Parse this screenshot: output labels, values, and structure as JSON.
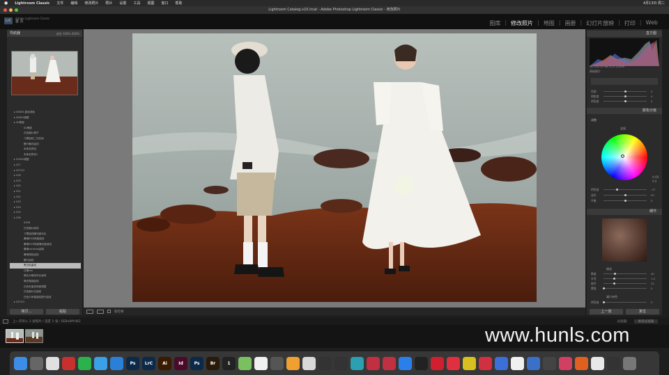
{
  "menubar": {
    "app": "Lightroom Classic",
    "items": [
      "文件",
      "编辑",
      "修改照片",
      "照片",
      "设置",
      "工具",
      "视图",
      "窗口",
      "帮助"
    ],
    "clock": "4月13日 周二"
  },
  "window": {
    "title": "Lightroom Catalog-v10.lrcat - Adobe Photoshop Lightroom Classic - 修改照片"
  },
  "identity": {
    "logo": "LrC",
    "line1": "Adobe Lightroom Classic",
    "line2": "首 页"
  },
  "modules": [
    {
      "label": "图库",
      "active": false
    },
    {
      "label": "修改照片",
      "active": true
    },
    {
      "label": "地图",
      "active": false
    },
    {
      "label": "画册",
      "active": false
    },
    {
      "label": "幻灯片放映",
      "active": false
    },
    {
      "label": "打印",
      "active": false
    },
    {
      "label": "Web",
      "active": false
    }
  ],
  "left_panel": {
    "navigator_title": "导航器",
    "nav_zoom": "适合  100%  400%",
    "presets": [
      {
        "t": "folder",
        "label": "S0603-蓝色调色"
      },
      {
        "t": "folder",
        "label": "S0603调整"
      },
      {
        "t": "folder",
        "label": "S0黑银"
      },
      {
        "t": "item",
        "label": "S0黑银"
      },
      {
        "t": "item",
        "label": "白色婚纱调子"
      },
      {
        "t": "item",
        "label": "习惯曲线二次应用"
      },
      {
        "t": "item",
        "label": "履行曝光曲线"
      },
      {
        "t": "item",
        "label": "未命名预设"
      },
      {
        "t": "item",
        "label": "未命名预设1"
      },
      {
        "t": "folder",
        "label": "S2603调整"
      },
      {
        "t": "folder",
        "label": "S27"
      },
      {
        "t": "folder",
        "label": "S27CH"
      },
      {
        "t": "folder",
        "label": "S28"
      },
      {
        "t": "folder",
        "label": "S29"
      },
      {
        "t": "folder",
        "label": "S30"
      },
      {
        "t": "folder",
        "label": "S31"
      },
      {
        "t": "folder",
        "label": "S32"
      },
      {
        "t": "folder",
        "label": "S33"
      },
      {
        "t": "folder",
        "label": "S34"
      },
      {
        "t": "folder",
        "label": "S35"
      },
      {
        "t": "folder",
        "label": "S36"
      },
      {
        "t": "item",
        "label": "0406"
      },
      {
        "t": "item",
        "label": "白色婚纱曲线"
      },
      {
        "t": "item",
        "label": "习惯曲线曝光度对比"
      },
      {
        "t": "item",
        "label": "暴晒RGB亮度曲线"
      },
      {
        "t": "item",
        "label": "暴晒RGB亮度曝光度曲线"
      },
      {
        "t": "item",
        "label": "暴晒contrast曲线"
      },
      {
        "t": "item",
        "label": "暴晒调色曲线"
      },
      {
        "t": "item",
        "label": "履行曲线"
      },
      {
        "t": "sel",
        "label": "黑白色曲线"
      },
      {
        "t": "item",
        "label": "日期feo"
      },
      {
        "t": "item",
        "label": "暗光大暗线对比曲线"
      },
      {
        "t": "item",
        "label": "暗光增强曲线"
      },
      {
        "t": "item",
        "label": "白色系曲线亮度调整"
      },
      {
        "t": "item",
        "label": "白色婚纱白曲线"
      },
      {
        "t": "item",
        "label": "白色中间调曲线提升曲线"
      },
      {
        "t": "folder",
        "label": "S37CH"
      }
    ],
    "btn_copy": "拷贝...",
    "btn_paste": "粘贴"
  },
  "right_panel": {
    "histogram_title": "直方图",
    "hist_info": "ISO 400   35 mm   f/1.4   1/1000",
    "orig_label": "原始照片",
    "color_grading_title": "颜色分级",
    "adjust_label": "调整",
    "global_label": "全局",
    "sliders_top": [
      {
        "label": "色相",
        "value": "0"
      },
      {
        "label": "饱和度",
        "value": "0"
      },
      {
        "label": "明亮度",
        "value": "0"
      }
    ],
    "sliders_cg": [
      {
        "label": "明亮度",
        "value": "-37"
      },
      {
        "label": "混合",
        "value": "50"
      },
      {
        "label": "平衡",
        "value": "0"
      }
    ],
    "wheel_h": "H 60",
    "wheel_s": "S 0",
    "detail_title": "细节",
    "sharpen_label": "锐化",
    "sliders_detail": [
      {
        "label": "数量",
        "value": "40"
      },
      {
        "label": "半径",
        "value": "1.0"
      },
      {
        "label": "细节",
        "value": "25"
      },
      {
        "label": "蒙版",
        "value": "0"
      }
    ],
    "nr_label": "减少杂色",
    "nr_slider": {
      "label": "明亮度",
      "value": "0"
    },
    "btn_prev": "上一张",
    "btn_reset": "复位"
  },
  "toolbar": {
    "softproof": "软打样"
  },
  "filmstrip": {
    "info": "上一次导入  2 张照片 / 选定 1 张 / 6EBe8ffr0K2",
    "filter": "过滤器：",
    "filter_value": "关闭过滤器"
  },
  "watermark": "www.hunls.com",
  "dock": [
    {
      "name": "finder-icon",
      "c": "#3b8de8",
      "t": ""
    },
    {
      "name": "launchpad-icon",
      "c": "#666",
      "t": ""
    },
    {
      "name": "chrome-icon",
      "c": "#e0e0e0",
      "t": ""
    },
    {
      "name": "app-icon",
      "c": "#c83030",
      "t": ""
    },
    {
      "name": "wechat-icon",
      "c": "#2bb24c",
      "t": ""
    },
    {
      "name": "qq-icon",
      "c": "#3aa0e8",
      "t": ""
    },
    {
      "name": "safari-icon",
      "c": "#2a80d8",
      "t": ""
    },
    {
      "name": "photoshop-icon",
      "c": "#0b2a4a",
      "t": "Ps"
    },
    {
      "name": "lightroom-icon",
      "c": "#0b2a4a",
      "t": "LrC"
    },
    {
      "name": "illustrator-icon",
      "c": "#3a1a00",
      "t": "Ai"
    },
    {
      "name": "indesign-icon",
      "c": "#4a0a2a",
      "t": "Id"
    },
    {
      "name": "photoshop2-icon",
      "c": "#0b2a4a",
      "t": "Ps"
    },
    {
      "name": "bridge-icon",
      "c": "#2a1a0a",
      "t": "Br"
    },
    {
      "name": "one-icon",
      "c": "#222",
      "t": "1"
    },
    {
      "name": "map-icon",
      "c": "#7ac060",
      "t": ""
    },
    {
      "name": "app2-icon",
      "c": "#f0f0f0",
      "t": ""
    },
    {
      "name": "app3-icon",
      "c": "#555",
      "t": ""
    },
    {
      "name": "photos-icon",
      "c": "#f0a030",
      "t": ""
    },
    {
      "name": "app4-icon",
      "c": "#d8d8d8",
      "t": ""
    },
    {
      "name": "video-icon",
      "c": "#333",
      "t": ""
    },
    {
      "name": "finalcut-icon",
      "c": "#333",
      "t": ""
    },
    {
      "name": "app5-icon",
      "c": "#2aa0b0",
      "t": ""
    },
    {
      "name": "app6-icon",
      "c": "#c03040",
      "t": ""
    },
    {
      "name": "app7-icon",
      "c": "#c03040",
      "t": ""
    },
    {
      "name": "appstore-icon",
      "c": "#2a80e8",
      "t": ""
    },
    {
      "name": "app8-icon",
      "c": "#222",
      "t": ""
    },
    {
      "name": "app9-icon",
      "c": "#d02030",
      "t": ""
    },
    {
      "name": "music-icon",
      "c": "#e03040",
      "t": ""
    },
    {
      "name": "app10-icon",
      "c": "#d8c020",
      "t": ""
    },
    {
      "name": "app11-icon",
      "c": "#d03040",
      "t": ""
    },
    {
      "name": "app12-icon",
      "c": "#3a70d8",
      "t": ""
    },
    {
      "name": "app13-icon",
      "c": "#f0f0f0",
      "t": ""
    },
    {
      "name": "app14-icon",
      "c": "#3a70c8",
      "t": ""
    },
    {
      "name": "app15-icon",
      "c": "#444",
      "t": ""
    },
    {
      "name": "app16-icon",
      "c": "#d04060",
      "t": ""
    },
    {
      "name": "app17-icon",
      "c": "#e06020",
      "t": ""
    },
    {
      "name": "notes-icon",
      "c": "#e8e8e8",
      "t": ""
    },
    {
      "name": "app18-icon",
      "c": "#333",
      "t": ""
    },
    {
      "name": "trash-icon",
      "c": "#777",
      "t": ""
    }
  ]
}
